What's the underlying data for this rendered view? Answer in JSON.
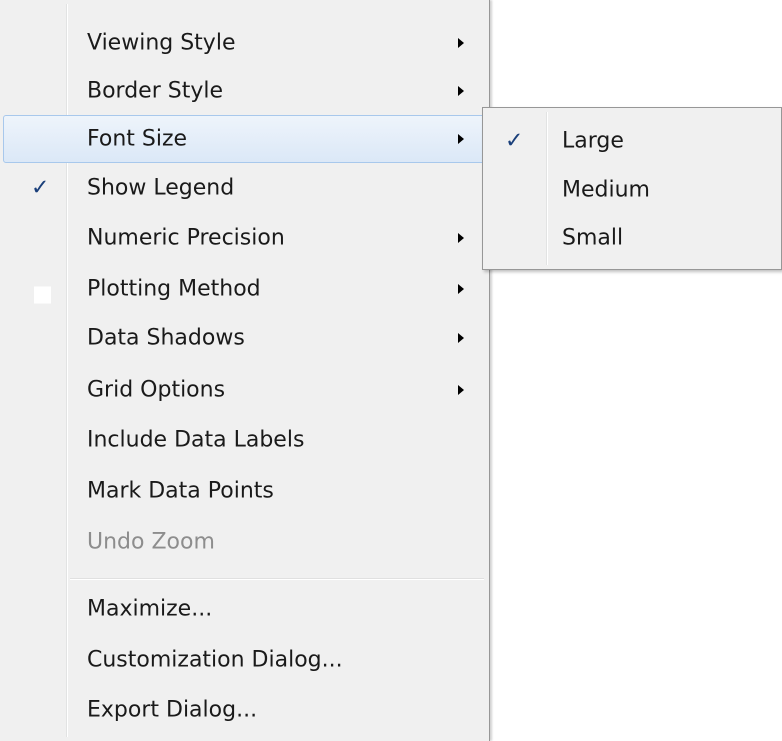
{
  "menu": {
    "items": [
      {
        "label": "Viewing Style"
      },
      {
        "label": "Border Style"
      },
      {
        "label": "Font Size"
      },
      {
        "label": "Show Legend",
        "check": "✓"
      },
      {
        "label": "Numeric Precision"
      },
      {
        "label": "Plotting Method"
      },
      {
        "label": "Data Shadows"
      },
      {
        "label": "Grid Options"
      },
      {
        "label": "Include Data Labels"
      },
      {
        "label": "Mark Data Points"
      },
      {
        "label": "Undo Zoom"
      },
      {
        "label": "Maximize..."
      },
      {
        "label": "Customization Dialog..."
      },
      {
        "label": "Export Dialog..."
      }
    ]
  },
  "submenu": {
    "items": [
      {
        "label": "Large",
        "check": "✓"
      },
      {
        "label": "Medium"
      },
      {
        "label": "Small"
      }
    ]
  },
  "colors": {
    "menu_bg": "#f0f0f0",
    "highlight_border": "#a8c8ec",
    "disabled_text": "#8d8d8d",
    "check": "#1a3f7a"
  }
}
